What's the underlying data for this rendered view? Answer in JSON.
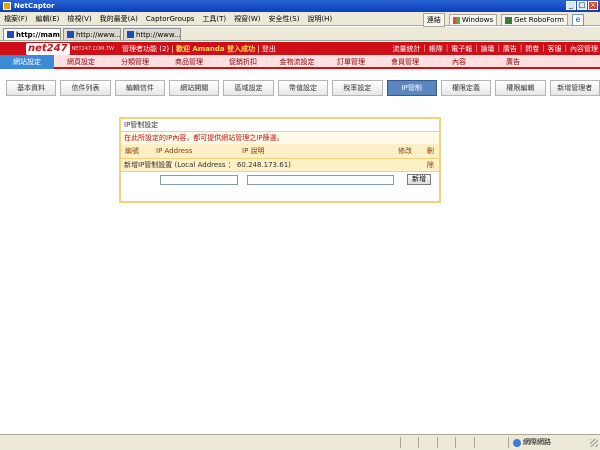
{
  "window": {
    "title": "NetCaptor",
    "buttons": [
      "_",
      "□",
      "×"
    ]
  },
  "menubar": {
    "items": [
      "檔案(F)",
      "編輯(E)",
      "檢視(V)",
      "我的最愛(A)",
      "CaptorGroups",
      "工具(T)",
      "視窗(W)",
      "安全性(S)",
      "說明(H)"
    ],
    "links_label": "連結",
    "windows_label": "Windows",
    "robo_label": "Get RoboForm"
  },
  "tabs": [
    {
      "label": "http://mam..."
    },
    {
      "label": "http://www..."
    },
    {
      "label": "http://www..."
    }
  ],
  "site": {
    "logo": "net247",
    "logo_sub": "NET247.COM.TW",
    "header_info_prefix": "管理者功能 (2)",
    "header_info_welcome": "歡迎 Amanda 登入成功",
    "header_info_logout": "登出",
    "top_links": [
      "流量統計",
      "帳隊",
      "電子報",
      "論壇",
      "廣告",
      "問卷",
      "客服",
      "內容管理"
    ]
  },
  "main_nav": {
    "active_index": 0,
    "items": [
      "網站設定",
      "網頁設定",
      "分類管理",
      "商品管理",
      "促銷折扣",
      "金物流設定",
      "訂單管理",
      "會員管理",
      "內容",
      "廣告"
    ]
  },
  "sub_nav": {
    "active_index": 8,
    "items": [
      "基本資料",
      "信件列表",
      "編輯信件",
      "網站開關",
      "區域設定",
      "幣值設定",
      "稅率設定",
      "IP管制",
      "權限定義",
      "權限編輯",
      "新增管理者"
    ]
  },
  "ip_panel": {
    "title": "IP管制設定",
    "description": "在此所設定的IP內容，都可提供網站管理之IP篩選。",
    "columns": {
      "id": "編號",
      "ip": "IP Address",
      "desc": "IP 說明",
      "edit": "修改",
      "delete": "刪除"
    },
    "local_label": "新增IP管制設置 (Local Address ： 60.248.173.61)",
    "ip_value": "",
    "desc_value": "",
    "add_button": "新增"
  },
  "statusbar": {
    "zone": "網際網路"
  }
}
